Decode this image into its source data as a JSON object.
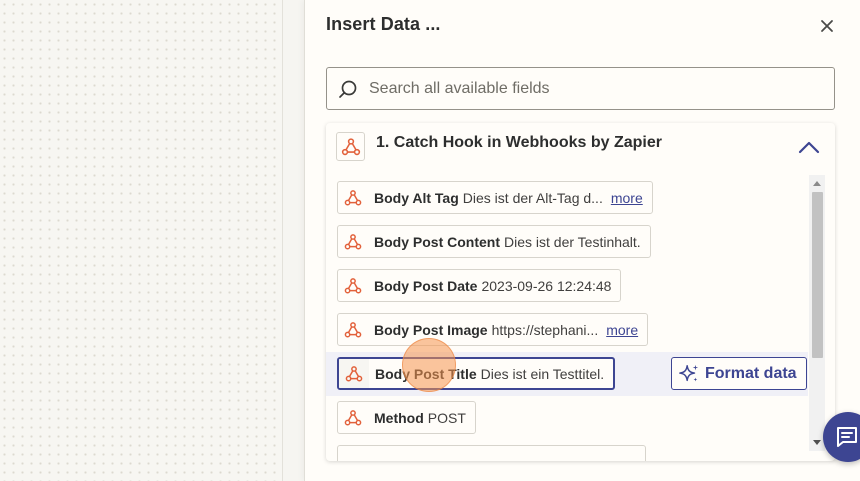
{
  "panel": {
    "title": "Insert Data ...",
    "close_icon": "close-icon"
  },
  "search": {
    "placeholder": "Search all available fields",
    "value": "",
    "icon": "search-icon"
  },
  "step": {
    "title": "1. Catch Hook in Webhooks by Zapier",
    "icon": "webhook-icon",
    "toggle_icon": "chevron-up-icon"
  },
  "fields": [
    {
      "name": "Body Alt Tag",
      "value": "Dies ist der Alt-Tag d...",
      "more": "more"
    },
    {
      "name": "Body Post Content",
      "value": "Dies ist der Testinhalt.",
      "more": ""
    },
    {
      "name": "Body Post Date",
      "value": "2023-09-26 12:24:48",
      "more": ""
    },
    {
      "name": "Body Post Image",
      "value": "https://stephani...",
      "more": "more"
    },
    {
      "name": "Body Post Title",
      "value": "Dies ist ein Testtitel.",
      "more": "",
      "selected": true
    },
    {
      "name": "Method",
      "value": "POST",
      "more": ""
    }
  ],
  "format_button": {
    "label": "Format data",
    "icon": "sparkle-icon"
  },
  "help": {
    "icon": "chat-icon"
  },
  "colors": {
    "accent": "#3d4592",
    "webhook_icon": "#e2613b",
    "cursor_highlight": "#f59650"
  }
}
